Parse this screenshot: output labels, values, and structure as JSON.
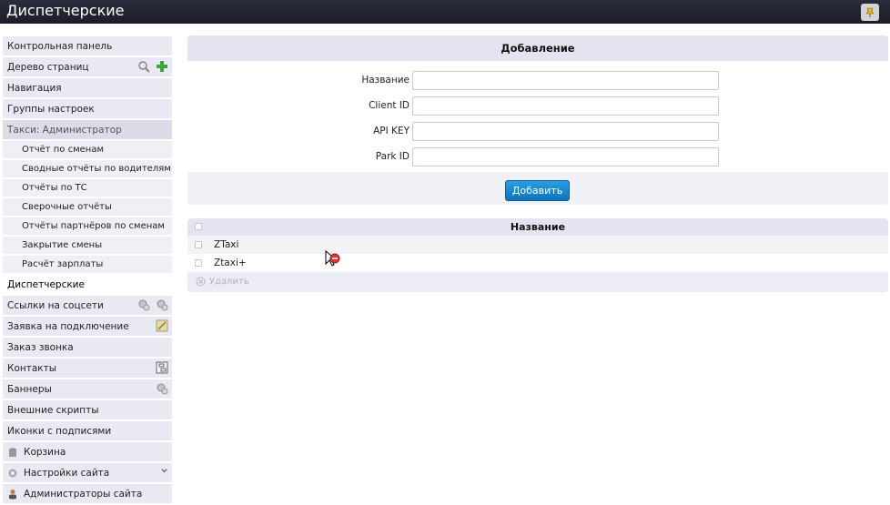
{
  "header": {
    "title": "Диспетчерские"
  },
  "sidebar": {
    "items": [
      {
        "label": "Контрольная панель"
      },
      {
        "label": "Дерево страниц"
      },
      {
        "label": "Навигация"
      },
      {
        "label": "Группы настроек"
      },
      {
        "label": "Такси: Администратор"
      },
      {
        "label": "Отчёт по сменам"
      },
      {
        "label": "Сводные отчёты по водителям"
      },
      {
        "label": "Отчёты по ТС"
      },
      {
        "label": "Сверочные отчёты"
      },
      {
        "label": "Отчёты партнёров по сменам"
      },
      {
        "label": "Закрытие смены"
      },
      {
        "label": "Расчёт зарплаты"
      },
      {
        "label": "Диспетчерские"
      },
      {
        "label": "Ссылки на соцсети"
      },
      {
        "label": "Заявка на подключение"
      },
      {
        "label": "Заказ звонка"
      },
      {
        "label": "Контакты"
      },
      {
        "label": "Баннеры"
      },
      {
        "label": "Внешние скрипты"
      },
      {
        "label": "Иконки с подписями"
      },
      {
        "label": "Корзина"
      },
      {
        "label": "Настройки сайта"
      },
      {
        "label": "Администраторы сайта"
      }
    ]
  },
  "form": {
    "title": "Добавление",
    "fields": [
      {
        "label": "Название",
        "value": ""
      },
      {
        "label": "Client ID",
        "value": ""
      },
      {
        "label": "API KEY",
        "value": ""
      },
      {
        "label": "Park ID",
        "value": ""
      }
    ],
    "submit_label": "Добавить"
  },
  "table": {
    "header": "Название",
    "rows": [
      {
        "name": "ZTaxi"
      },
      {
        "name": "Ztaxi+"
      }
    ],
    "delete_label": "Удалить"
  },
  "colors": {
    "accent": "#1a86cf",
    "topbar": "#23242f"
  }
}
